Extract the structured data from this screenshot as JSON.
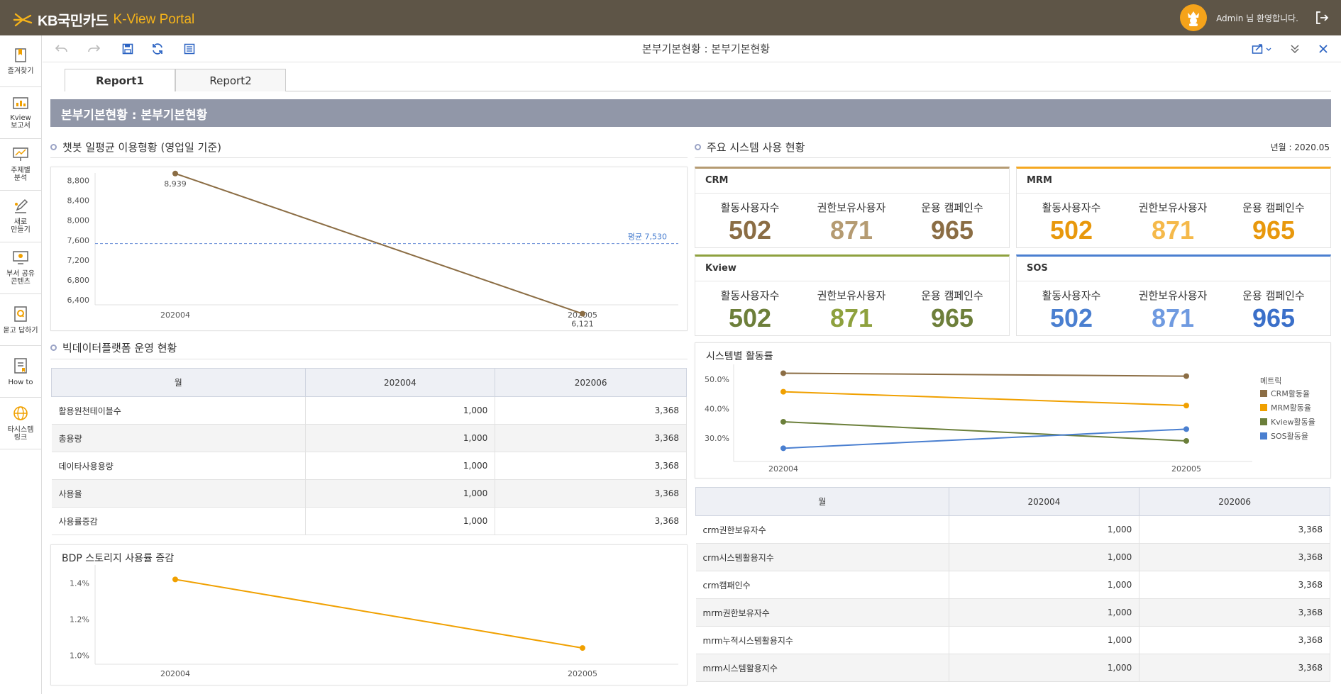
{
  "app": {
    "brand": "KB국민카드",
    "portal": "K-View Portal",
    "user": "Admin 님 환영합니다."
  },
  "window_title": "본부기본현황 : 본부기본현황",
  "sidebar": {
    "items": [
      {
        "label": "즐겨찾기",
        "icon": "bookmark-icon"
      },
      {
        "label": "Kview\n보고서",
        "icon": "report-icon"
      },
      {
        "label": "주제별\n분석",
        "icon": "presentation-icon"
      },
      {
        "label": "새로\n만들기",
        "icon": "edit-icon"
      },
      {
        "label": "부서 공유\n콘텐츠",
        "icon": "monitor-share-icon"
      },
      {
        "label": "묻고 답하기",
        "icon": "qa-icon"
      },
      {
        "label": "How to",
        "icon": "guide-icon"
      },
      {
        "label": "타시스템\n링크",
        "icon": "globe-icon"
      }
    ]
  },
  "tabs": [
    {
      "label": "Report1",
      "active": true
    },
    {
      "label": "Report2",
      "active": false
    }
  ],
  "banner": "본부기본현황 : 본부기본현황",
  "chatbot": {
    "title": "챗봇 일평균 이용형황 (영업일 기준)",
    "avg_label": "평균 7,530",
    "chart_data": {
      "type": "line",
      "x": [
        "202004",
        "202005"
      ],
      "values": [
        8939,
        6121
      ],
      "value_labels": [
        "8,939",
        "6,121"
      ],
      "yticks": [
        "8,800",
        "8,400",
        "8,000",
        "7,600",
        "7,200",
        "6,800",
        "6,400"
      ],
      "ylim": [
        6300,
        8950
      ],
      "average": 7530,
      "color": "#8b6d44"
    }
  },
  "bigdata": {
    "title": "빅데이터플랫폼 운영 현황",
    "columns": [
      "월",
      "202004",
      "202006"
    ],
    "rows": [
      [
        "활용원천테이블수",
        "1,000",
        "3,368"
      ],
      [
        "총용량",
        "1,000",
        "3,368"
      ],
      [
        "데이타사용용량",
        "1,000",
        "3,368"
      ],
      [
        "사용율",
        "1,000",
        "3,368"
      ],
      [
        "사용률증감",
        "1,000",
        "3,368"
      ]
    ]
  },
  "bdp": {
    "title": "BDP 스토리지 사용률 증감",
    "chart_data": {
      "type": "line",
      "x": [
        "202004",
        "202005"
      ],
      "values": [
        1.42,
        1.04
      ],
      "yticks": [
        "1.4%",
        "1.2%",
        "1.0%"
      ],
      "ylim": [
        0.95,
        1.5
      ],
      "color": "#f0a000"
    }
  },
  "systems": {
    "title": "주요 시스템 사용 현황",
    "date": "년월 : 2020.05",
    "metric_labels": [
      "활동사용자수",
      "권한보유사용자",
      "운용 캠페인수"
    ],
    "cards": [
      {
        "name": "CRM",
        "values": [
          "502",
          "871",
          "965"
        ],
        "colors": [
          "#8b6d44",
          "#b59b72",
          "#8b6d44"
        ],
        "accent": "#b59b72"
      },
      {
        "name": "MRM",
        "values": [
          "502",
          "871",
          "965"
        ],
        "colors": [
          "#e8980c",
          "#f5b94a",
          "#e8980c"
        ],
        "accent": "#f5a821"
      },
      {
        "name": "Kview",
        "values": [
          "502",
          "871",
          "965"
        ],
        "colors": [
          "#6d7f3a",
          "#8ea13e",
          "#6d7f3a"
        ],
        "accent": "#8ea13e"
      },
      {
        "name": "SOS",
        "values": [
          "502",
          "871",
          "965"
        ],
        "colors": [
          "#4a7fd0",
          "#6f9ae0",
          "#3a6fc9"
        ],
        "accent": "#4a7fd0"
      }
    ]
  },
  "activity": {
    "title": "시스템별 활동률",
    "chart_data": {
      "type": "line",
      "x": [
        "202004",
        "202005"
      ],
      "yticks": [
        "50.0%",
        "40.0%",
        "30.0%"
      ],
      "ylim": [
        22,
        55
      ],
      "legend_title": "메트릭",
      "series": [
        {
          "name": "CRM활동율",
          "values": [
            52,
            51
          ],
          "color": "#8b6d44"
        },
        {
          "name": "MRM활동율",
          "values": [
            45.7,
            41
          ],
          "color": "#f0a000"
        },
        {
          "name": "Kview활동율",
          "values": [
            35.5,
            29
          ],
          "color": "#6b7f3a"
        },
        {
          "name": "SOS활동율",
          "values": [
            26.5,
            33
          ],
          "color": "#4a7fd0"
        }
      ]
    }
  },
  "systable": {
    "columns": [
      "월",
      "202004",
      "202006"
    ],
    "rows": [
      [
        "crm권한보유자수",
        "1,000",
        "3,368"
      ],
      [
        "crm시스템활용지수",
        "1,000",
        "3,368"
      ],
      [
        "crm캠패인수",
        "1,000",
        "3,368"
      ],
      [
        "mrm권한보유자수",
        "1,000",
        "3,368"
      ],
      [
        "mrm누적시스템활용지수",
        "1,000",
        "3,368"
      ],
      [
        "mrm시스템활용지수",
        "1,000",
        "3,368"
      ]
    ]
  }
}
